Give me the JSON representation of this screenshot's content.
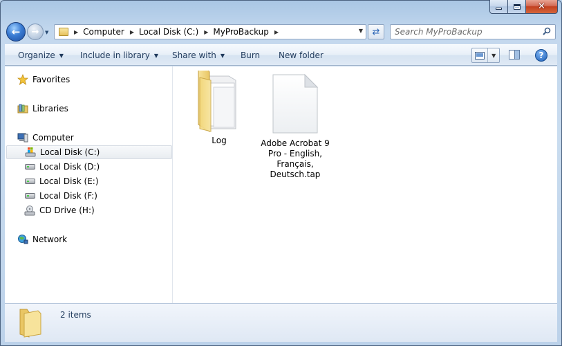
{
  "window": {
    "controls": {
      "minimize": "minimize-icon",
      "maximize": "maximize-icon",
      "close": "close-icon"
    }
  },
  "nav": {
    "back": "back-arrow-icon",
    "forward": "forward-arrow-icon"
  },
  "address": {
    "breadcrumbs": [
      "Computer",
      "Local Disk (C:)",
      "MyProBackup"
    ]
  },
  "search": {
    "placeholder": "Search MyProBackup"
  },
  "toolbar": {
    "organize": "Organize",
    "include_in_library": "Include in library",
    "share_with": "Share with",
    "burn": "Burn",
    "new_folder": "New folder",
    "help": "?"
  },
  "sidebar": {
    "favorites": "Favorites",
    "libraries": "Libraries",
    "computer": "Computer",
    "drives": [
      {
        "label": "Local Disk (C:)",
        "selected": true
      },
      {
        "label": "Local Disk (D:)"
      },
      {
        "label": "Local Disk (E:)"
      },
      {
        "label": "Local Disk (F:)"
      },
      {
        "label": "CD Drive (H:)"
      }
    ],
    "network": "Network"
  },
  "files": [
    {
      "name": "Log",
      "type": "folder"
    },
    {
      "name_lines": [
        "Adobe Acrobat 9",
        "Pro - English,",
        "Français,",
        "Deutsch.tap"
      ],
      "type": "file"
    }
  ],
  "details": {
    "count": "2 items"
  },
  "colors": {
    "accent": "#1e395b",
    "selection": "#e9edf1",
    "folder": "#e6c15c"
  }
}
